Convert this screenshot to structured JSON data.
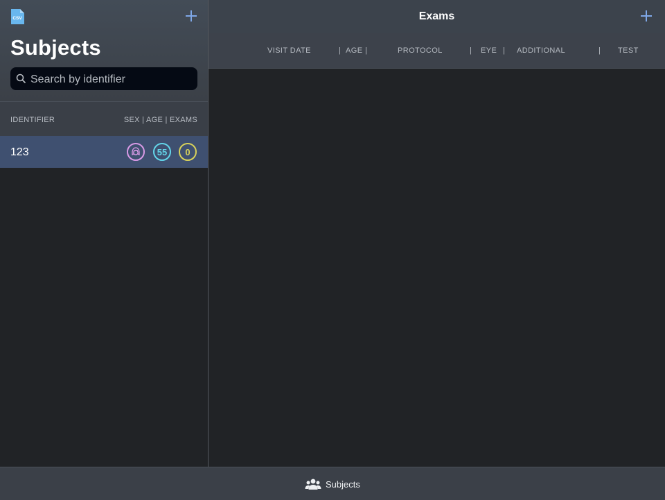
{
  "sidebar": {
    "title": "Subjects",
    "search": {
      "placeholder": "Search by identifier",
      "value": ""
    },
    "columns": {
      "identifier": "IDENTIFIER",
      "right": "SEX | AGE | EXAMS"
    },
    "rows": [
      {
        "identifier": "123",
        "sex_icon": "female-face-icon",
        "age": "55",
        "exams": "0"
      }
    ]
  },
  "main": {
    "title": "Exams",
    "columns": {
      "visit_date": "VISIT DATE",
      "sep1": "|",
      "age": "AGE",
      "sep2": "|",
      "protocol": "PROTOCOL",
      "sep3": "|",
      "eye": "EYE",
      "sep4": "|",
      "additional": "ADDITIONAL",
      "sep5": "|",
      "test": "TEST"
    }
  },
  "tabbar": {
    "subjects_label": "Subjects"
  },
  "colors": {
    "accent": "#7fa8e8",
    "selected_row": "#3f5070",
    "sex_badge": "#d99ae6",
    "age_badge": "#63d6ea",
    "exams_badge": "#d9d25a"
  }
}
